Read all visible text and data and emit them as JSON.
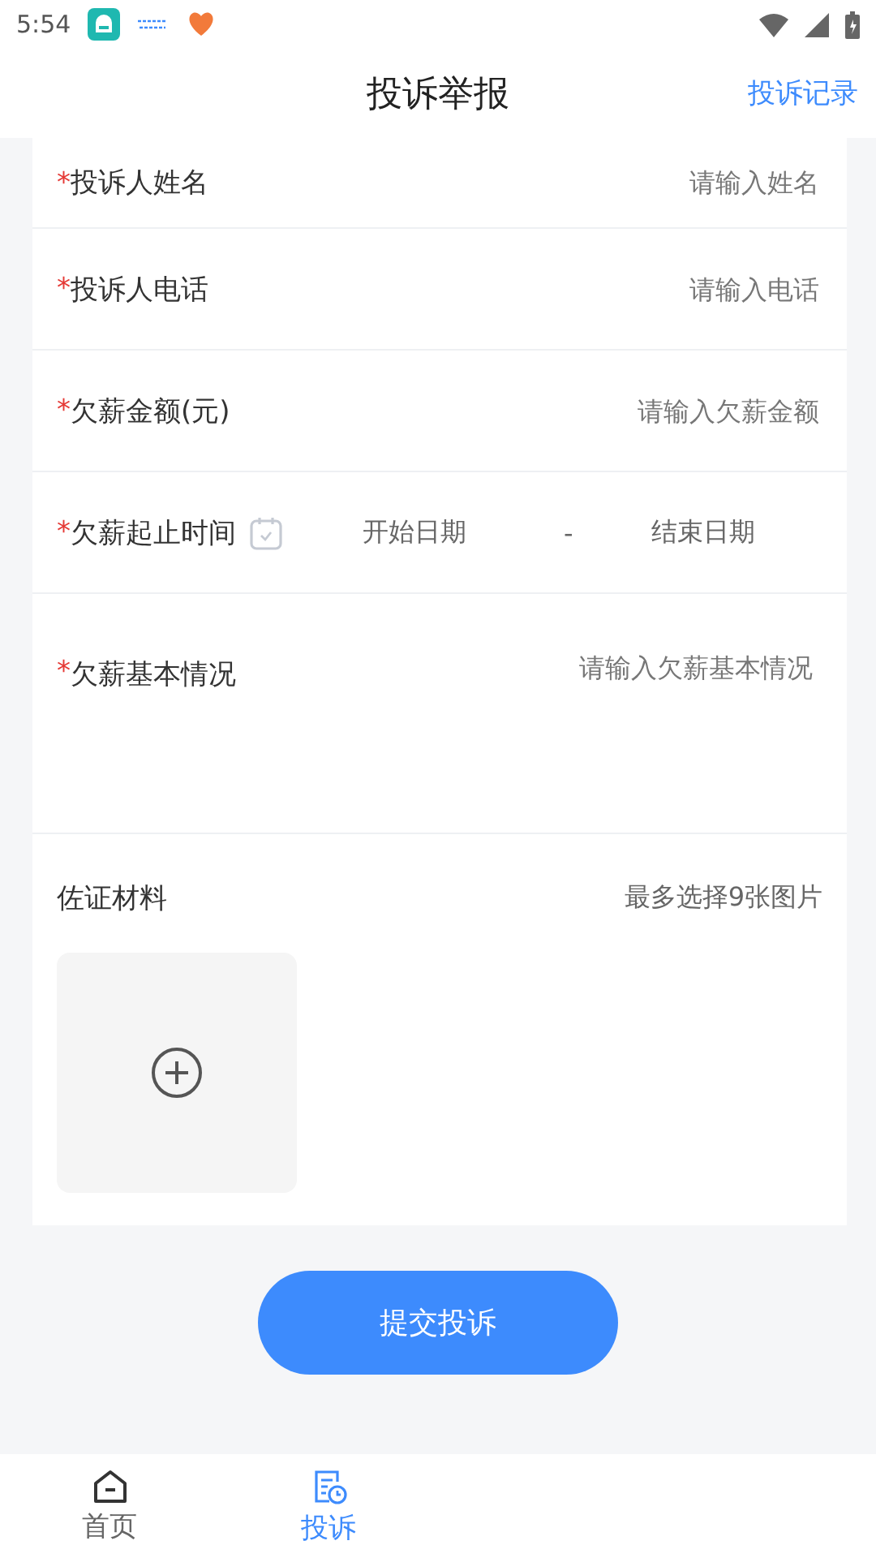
{
  "status_bar": {
    "time": "5:54"
  },
  "header": {
    "title": "投诉举报",
    "link": "投诉记录"
  },
  "fields": [
    {
      "kind": "text",
      "mark": "*",
      "label": "投诉人姓名",
      "placeholder": "请输入姓名"
    },
    {
      "kind": "text",
      "mark": "*",
      "label": "投诉人电话",
      "placeholder": "请输入电话"
    },
    {
      "kind": "text",
      "mark": "*",
      "label": "欠薪金额(元)",
      "placeholder": "请输入欠薪金额"
    },
    {
      "kind": "date",
      "mark": "*",
      "label": "欠薪起止时间",
      "start_placeholder": "开始日期",
      "separator": "-",
      "end_placeholder": "结束日期"
    },
    {
      "kind": "textarea",
      "mark": "*",
      "label": "欠薪基本情况",
      "placeholder": "请输入欠薪基本情况"
    }
  ],
  "upload": {
    "label": "佐证材料",
    "hint": "最多选择9张图片"
  },
  "submit": "提交投诉",
  "tabs": [
    {
      "kind": "home",
      "label": "首页",
      "selected": false
    },
    {
      "kind": "complaint",
      "label": "投诉",
      "selected": true
    }
  ]
}
